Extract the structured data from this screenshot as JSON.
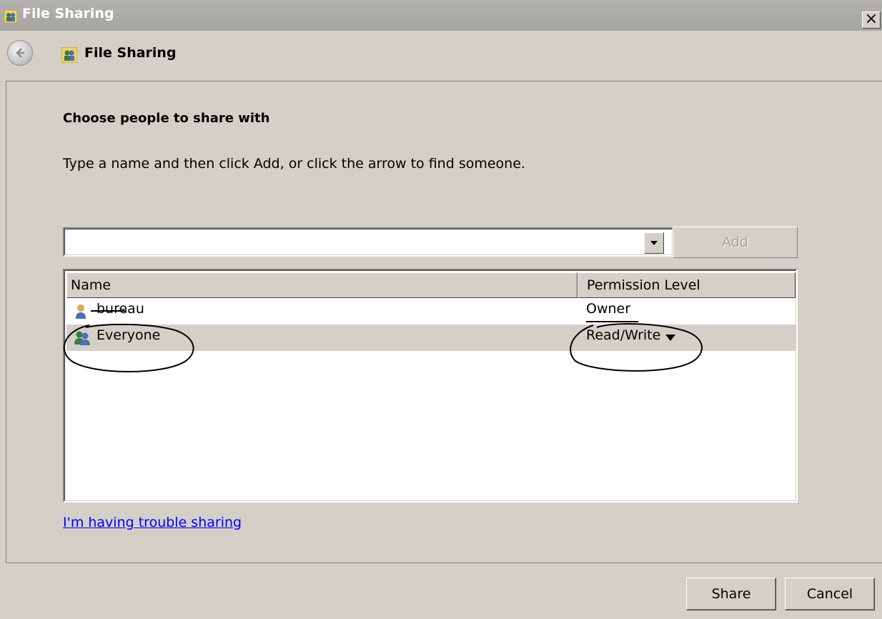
{
  "window": {
    "title": "File Sharing",
    "close_glyph": "×"
  },
  "nav": {
    "title": "File Sharing",
    "back_icon": "back-arrow-icon"
  },
  "main": {
    "heading": "Choose people to share with",
    "instruction": "Type a name and then click Add, or click the arrow to find someone.",
    "name_input": {
      "value": "",
      "placeholder": ""
    },
    "add_label": "Add"
  },
  "list": {
    "columns": [
      "Name",
      "Permission Level"
    ],
    "rows": [
      {
        "name": "bureau",
        "permission": "Owner",
        "icon": "user-icon"
      },
      {
        "name": "Everyone",
        "permission": "Read/Write",
        "icon": "group-icon"
      }
    ]
  },
  "trouble_link": "I'm having trouble sharing",
  "buttons": {
    "share": "Share",
    "cancel": "Cancel"
  },
  "colors": {
    "dialog_bg": "#d4d0c8",
    "link": "#0000ff",
    "title_text": "#ffffff"
  }
}
